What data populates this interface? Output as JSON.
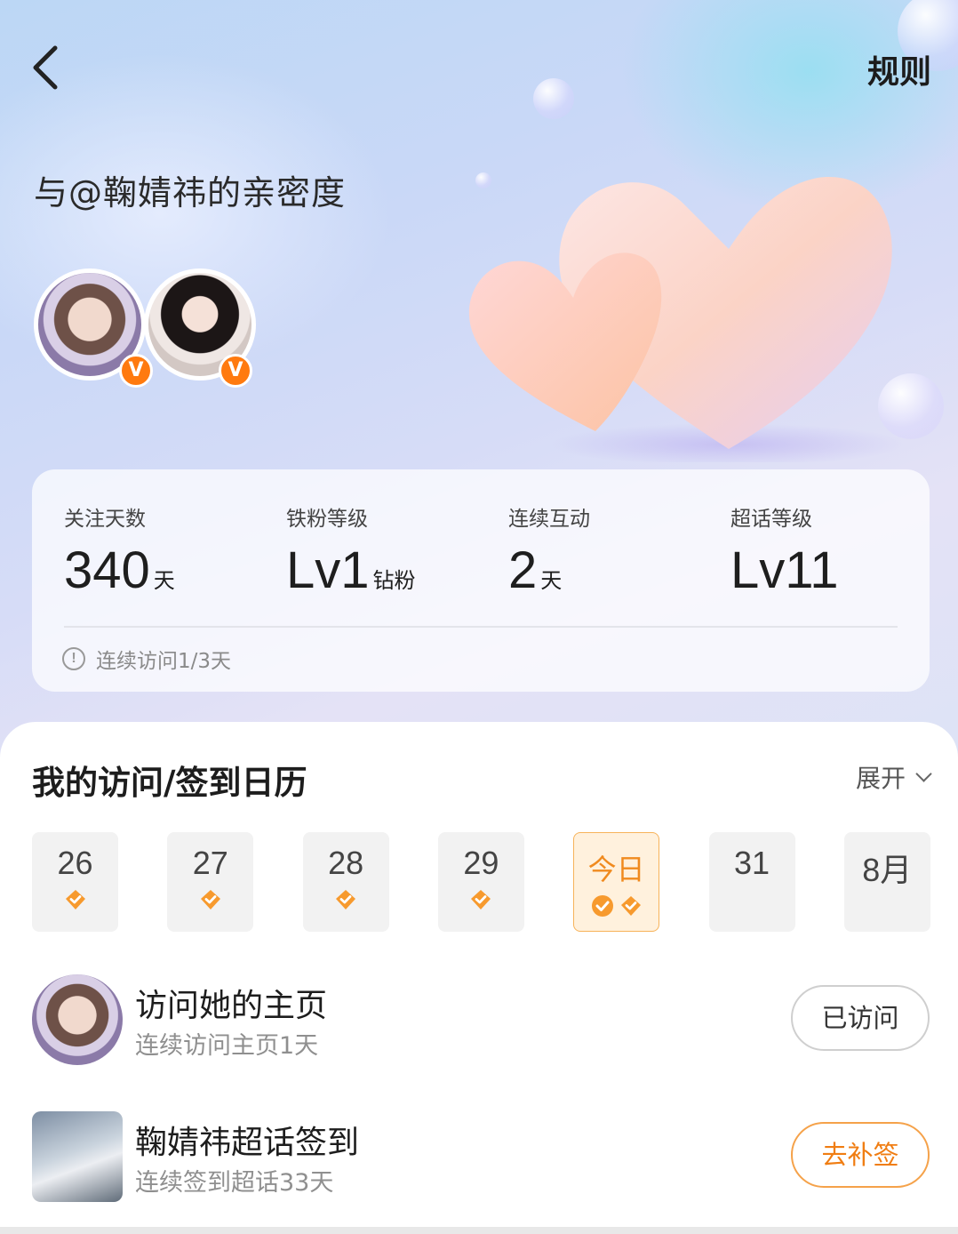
{
  "header": {
    "back_label": "",
    "rules_label": "规则",
    "title": "与@鞠婧祎的亲密度"
  },
  "avatars": {
    "badge": "V"
  },
  "stats": {
    "items": [
      {
        "label": "关注天数",
        "value": "340",
        "unit": "天"
      },
      {
        "label": "铁粉等级",
        "value": "Lv1",
        "unit": "钻粉"
      },
      {
        "label": "连续互动",
        "value": "2",
        "unit": "天"
      },
      {
        "label": "超话等级",
        "value": "Lv11",
        "unit": ""
      }
    ],
    "note": "连续访问1/3天"
  },
  "calendar": {
    "title": "我的访问/签到日历",
    "expand_label": "展开",
    "days": [
      {
        "label": "26",
        "checks": 1
      },
      {
        "label": "27",
        "checks": 1
      },
      {
        "label": "28",
        "checks": 1
      },
      {
        "label": "29",
        "checks": 1
      },
      {
        "label": "今日",
        "checks": 2,
        "today": true
      },
      {
        "label": "31",
        "checks": 0
      },
      {
        "label": "8月",
        "checks": 0
      }
    ]
  },
  "tasks": [
    {
      "title": "访问她的主页",
      "subtitle": "连续访问主页1天",
      "button": "已访问",
      "state": "done"
    },
    {
      "title": "鞠婧祎超话签到",
      "subtitle": "连续签到超话33天",
      "button": "去补签",
      "state": "todo"
    }
  ],
  "colors": {
    "accent": "#f07d12",
    "badge": "#ff7a0f",
    "check": "#f79a2e"
  }
}
